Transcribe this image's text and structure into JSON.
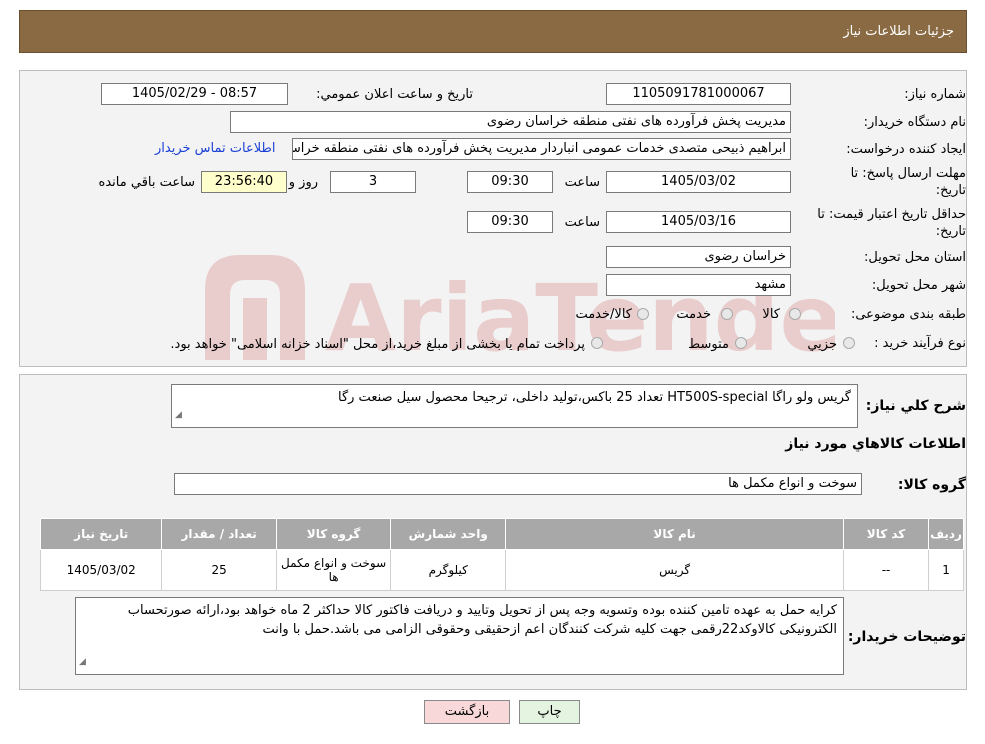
{
  "header": {
    "title": "جزئیات اطلاعات نیاز"
  },
  "labels": {
    "need_number": "شماره نیاز:",
    "announce_datetime": "تاریخ و ساعت اعلان عمومي:",
    "buyer_org": "نام دستگاه خریدار:",
    "requester": "ایجاد کننده درخواست:",
    "reply_deadline_line1": "مهلت ارسال پاسخ: تا",
    "reply_deadline_line2": "تاریخ:",
    "time": "ساعت",
    "day_and": "روز و",
    "remaining": "ساعت باقي مانده",
    "price_validity_line1": "حداقل تاریخ اعتبار قیمت: تا",
    "price_validity_line2": "تاریخ:",
    "province": "استان محل تحویل:",
    "city": "شهر محل تحویل:",
    "category": "طبقه بندی موضوعی:",
    "process": "نوع فرآیند خرید :",
    "description": "شرح کلي نیاز:",
    "goods_info": "اطلاعات کالاهاي مورد نیاز",
    "goods_group": "گروه کالا:",
    "buyer_notes": "توضیحات خریدار:"
  },
  "values": {
    "need_number": "1105091781000067",
    "announce_datetime": "1405/02/29 - 08:57",
    "buyer_org": "مدیریت پخش فرآورده های نفتی منطقه خراسان رضوی",
    "requester": "ابراهیم ذبیحی متصدی خدمات عمومی انباردار مدیریت پخش فرآورده های نفتی منطقه خراسان رضوی",
    "contact_link": "اطلاعات تماس خریدار",
    "reply_date": "1405/03/02",
    "reply_time": "09:30",
    "reply_days": "3",
    "reply_remaining": "23:56:40",
    "validity_date": "1405/03/16",
    "validity_time": "09:30",
    "province": "خراسان رضوی",
    "city": "مشهد",
    "description": "گریس ولو راگا HT500S-special تعداد 25 باکس،تولید داخلی، ترجیحا محصول سیل صنعت رگا",
    "goods_group": "سوخت و انواع مکمل ها",
    "buyer_notes": "کرایه حمل به عهده تامین کننده بوده وتسویه وجه پس از تحویل وتایید و دریافت فاکتور کالا حداکثر 2 ماه خواهد بود،ارائه صورتحساب الکترونیکی کالاوکد22رقمی جهت کلیه شرکت کنندگان اعم ازحقیقی وحقوقی الزامی می باشد.حمل با وانت"
  },
  "category_options": {
    "goods": "کالا",
    "service": "خدمت",
    "goods_service": "کالا/خدمت"
  },
  "process_options": {
    "partial": "جزیي",
    "medium": "متوسط",
    "note": "پرداخت تمام یا بخشی از مبلغ خرید،از محل \"اسناد خزانه اسلامی\" خواهد بود."
  },
  "table": {
    "headers": [
      "ردیف",
      "کد کالا",
      "نام کالا",
      "واحد شمارش",
      "گروه کالا",
      "تعداد / مقدار",
      "تاریخ نیاز"
    ],
    "rows": [
      [
        "1",
        "--",
        "گریس",
        "کیلوگرم",
        "سوخت و انواع مکمل ها",
        "25",
        "1405/03/02"
      ]
    ]
  },
  "buttons": {
    "print": "چاپ",
    "back": "بازگشت"
  },
  "watermark": {
    "text": "AriaTender.neT"
  },
  "colors": {
    "header_bg": "#8a6a43",
    "link": "#1a3fd6",
    "back_bg": "#f8d8d8",
    "print_bg": "#e4f4e0"
  }
}
